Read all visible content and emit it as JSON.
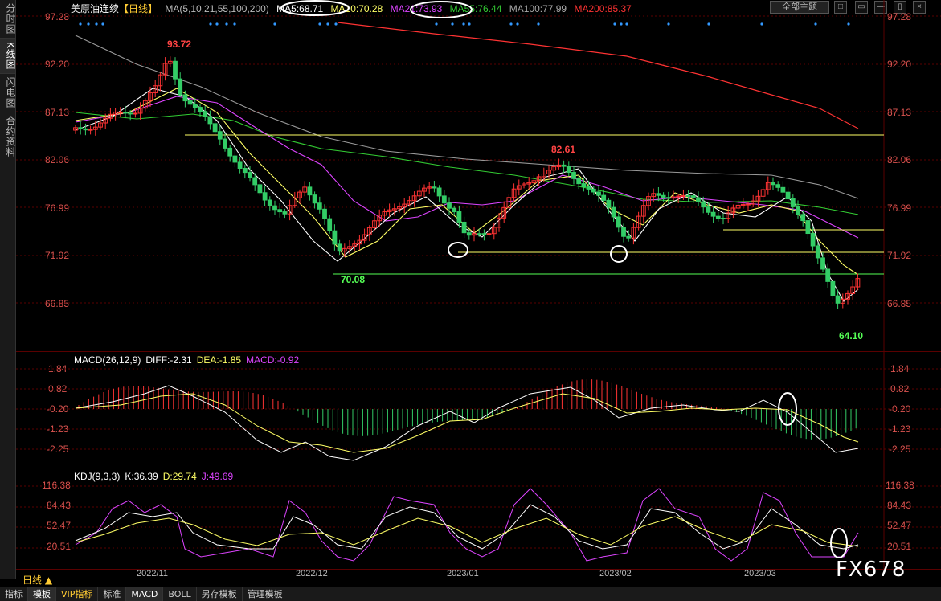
{
  "sidebar": {
    "tabs": [
      {
        "label": "分时图",
        "active": false
      },
      {
        "label": "K线图",
        "active": true
      },
      {
        "label": "闪电图",
        "active": false
      },
      {
        "label": "合约资料",
        "active": false
      }
    ]
  },
  "header": {
    "instrument": "美原油连续",
    "period": "【日线】",
    "ma_params": "MA(5,10,21,55,100,200)",
    "ma_items": [
      {
        "label": "MA5:68.71",
        "color": "#ffffff"
      },
      {
        "label": "MA10:70.28",
        "color": "#ffff66"
      },
      {
        "label": "MA21:73.93",
        "color": "#dd44ff"
      },
      {
        "label": "MA55:76.44",
        "color": "#33cc33"
      },
      {
        "label": "MA100:77.99",
        "color": "#aaaaaa"
      },
      {
        "label": "MA200:85.37",
        "color": "#ff3333"
      }
    ],
    "theme_select": "全部主题",
    "window_btns": [
      "□",
      "▭",
      "—",
      "▯",
      "×"
    ]
  },
  "price_axis": [
    "97.28",
    "92.20",
    "87.13",
    "82.06",
    "76.99",
    "71.92",
    "66.85"
  ],
  "annotations": {
    "high1": "93.72",
    "high2": "82.61",
    "low1": "70.08",
    "low2": "64.10"
  },
  "macd": {
    "title": "MACD(26,12,9)",
    "diff": "DIFF:-2.31",
    "dea": "DEA:-1.85",
    "macd": "MACD:-0.92",
    "ticks": [
      "1.84",
      "0.82",
      "-0.20",
      "-1.23",
      "-2.25"
    ]
  },
  "kdj": {
    "title": "KDJ(9,3,3)",
    "k": "K:36.39",
    "d": "D:29.74",
    "j": "J:49.69",
    "ticks": [
      "116.38",
      "84.43",
      "52.47",
      "20.51"
    ]
  },
  "dates": [
    "2022/11",
    "2022/12",
    "2023/01",
    "2023/02",
    "2023/03"
  ],
  "daily_label": "日线 ▲",
  "toolbar": [
    "指标",
    "模板",
    "VIP指标",
    "标准",
    "MACD",
    "BOLL",
    "另存模板",
    "管理模板"
  ],
  "watermark": "FX678",
  "colors": {
    "up": "#ff3333",
    "down": "#33cc66",
    "grid": "#5a0000",
    "axis": "#d9534f"
  },
  "chart_data": {
    "type": "candlestick",
    "price_range": [
      64.1,
      97.28
    ],
    "swing_points": [
      {
        "date": "2022/11",
        "price": 93.72,
        "kind": "high"
      },
      {
        "date": "2022/12",
        "price": 70.08,
        "kind": "low"
      },
      {
        "date": "2023/01",
        "price": 82.61,
        "kind": "high"
      },
      {
        "date": "2023/03",
        "price": 64.1,
        "kind": "low"
      }
    ],
    "horizontal_levels": [
      84.9,
      74.2,
      72.1,
      70.08
    ]
  }
}
